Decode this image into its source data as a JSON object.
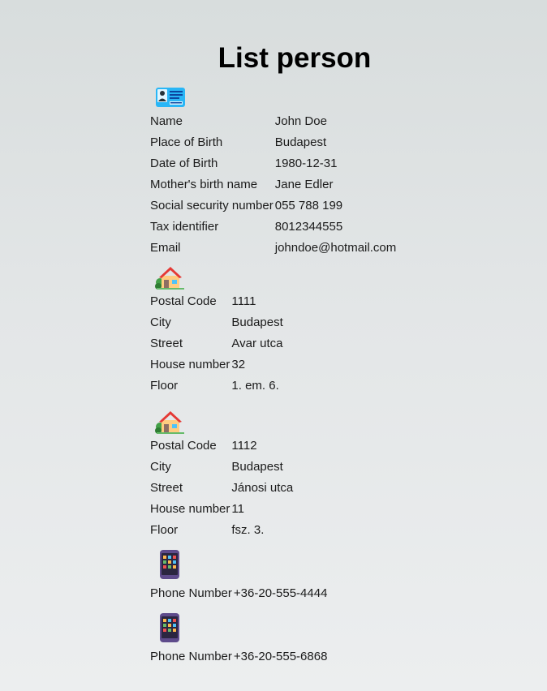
{
  "title": "List person",
  "person": {
    "icon": "id-card-icon",
    "fields": [
      {
        "label": "Name",
        "value": "John Doe"
      },
      {
        "label": "Place of Birth",
        "value": "Budapest"
      },
      {
        "label": "Date of Birth",
        "value": "1980-12-31"
      },
      {
        "label": "Mother's birth name",
        "value": "Jane Edler"
      },
      {
        "label": "Social security number",
        "value": "055 788 199"
      },
      {
        "label": "Tax identifier",
        "value": "8012344555"
      },
      {
        "label": "Email",
        "value": "johndoe@hotmail.com"
      }
    ]
  },
  "addresses": [
    {
      "icon": "house-icon",
      "fields": [
        {
          "label": "Postal Code",
          "value": "1111"
        },
        {
          "label": "City",
          "value": "Budapest"
        },
        {
          "label": "Street",
          "value": "Avar utca"
        },
        {
          "label": "House number",
          "value": "32"
        },
        {
          "label": "Floor",
          "value": "1. em. 6."
        }
      ]
    },
    {
      "icon": "house-icon",
      "fields": [
        {
          "label": "Postal Code",
          "value": "1112"
        },
        {
          "label": "City",
          "value": "Budapest"
        },
        {
          "label": "Street",
          "value": "Jánosi utca"
        },
        {
          "label": "House number",
          "value": "11"
        },
        {
          "label": "Floor",
          "value": "fsz. 3."
        }
      ]
    }
  ],
  "phones": [
    {
      "icon": "mobile-phone-icon",
      "label": "Phone Number",
      "value": "+36-20-555-4444"
    },
    {
      "icon": "mobile-phone-icon",
      "label": "Phone Number",
      "value": "+36-20-555-6868"
    }
  ]
}
